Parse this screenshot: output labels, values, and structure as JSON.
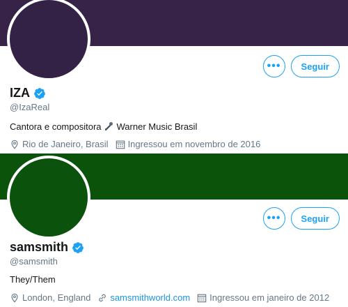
{
  "colors": {
    "accent": "#1da1f2",
    "card1_banner": "#372348",
    "card1_avatar": "#332245",
    "card2_banner": "#0b520b",
    "card2_avatar": "#0b530c"
  },
  "profiles": [
    {
      "name": "IZA",
      "handle": "@IzaReal",
      "bio": "Cantora e compositora",
      "bio_icon": "microphone-emoji-icon",
      "bio_suffix": "Warner Music Brasil",
      "location": "Rio de Janeiro, Brasil",
      "joined": "Ingressou em novembro de 2016",
      "more_label": "•••",
      "follow_label": "Seguir"
    },
    {
      "name": "samsmith",
      "handle": "@samsmith",
      "bio": "They/Them",
      "location": "London, England",
      "website": "samsmithworld.com",
      "joined": "Ingressou em janeiro de 2012",
      "more_label": "•••",
      "follow_label": "Seguir"
    }
  ]
}
